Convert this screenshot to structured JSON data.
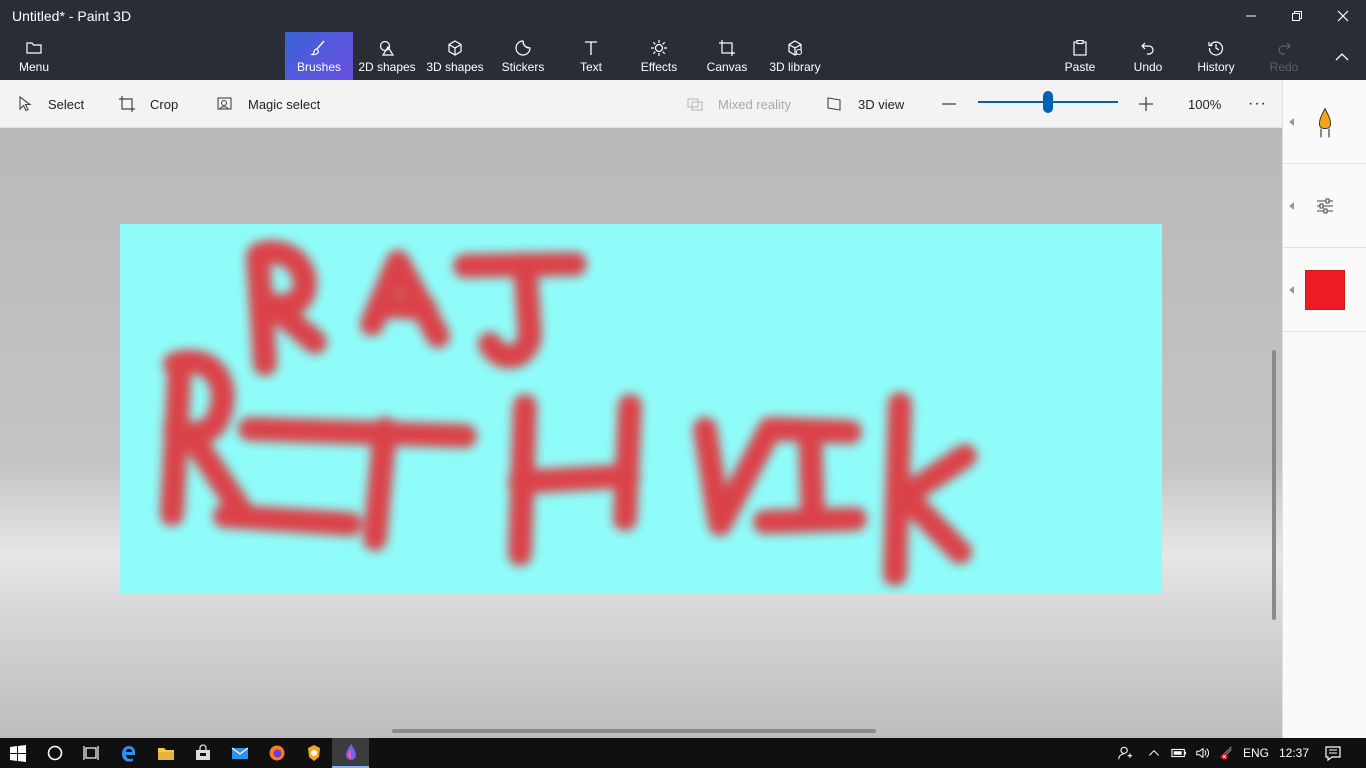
{
  "window": {
    "title": "Untitled* - Paint 3D"
  },
  "ribbon": {
    "menu_label": "Menu",
    "tabs": [
      {
        "label": "Brushes",
        "icon": "brush-icon",
        "active": true
      },
      {
        "label": "2D shapes",
        "icon": "2d-shapes-icon"
      },
      {
        "label": "3D shapes",
        "icon": "3d-shapes-icon"
      },
      {
        "label": "Stickers",
        "icon": "stickers-icon"
      },
      {
        "label": "Text",
        "icon": "text-icon"
      },
      {
        "label": "Effects",
        "icon": "effects-icon"
      },
      {
        "label": "Canvas",
        "icon": "canvas-icon"
      },
      {
        "label": "3D library",
        "icon": "3d-library-icon"
      }
    ],
    "paste_label": "Paste",
    "undo_label": "Undo",
    "history_label": "History",
    "redo_label": "Redo"
  },
  "toolbar": {
    "select_label": "Select",
    "crop_label": "Crop",
    "magic_select_label": "Magic select",
    "mixed_reality_label": "Mixed reality",
    "view3d_label": "3D view",
    "zoom_percent": "100%",
    "zoom_level": 0.5,
    "more_label": "···"
  },
  "canvas": {
    "background_color": "#8ffcf9",
    "stroke_color": "#e8222b",
    "painted_text_line1": "RAJ",
    "painted_text_line2": "RITHVIK"
  },
  "side_panel": {
    "brush_icon": "marker-brush-icon",
    "settings_icon": "sliders-icon",
    "color_swatch": "#ed1c24"
  },
  "taskbar": {
    "apps": [
      "start-icon",
      "cortana-icon",
      "task-view-icon",
      "edge-icon",
      "file-explorer-icon",
      "store-icon",
      "mail-icon",
      "firefox-icon",
      "brave-icon",
      "paint-3d-icon"
    ],
    "language": "ENG",
    "time": "12:37"
  }
}
